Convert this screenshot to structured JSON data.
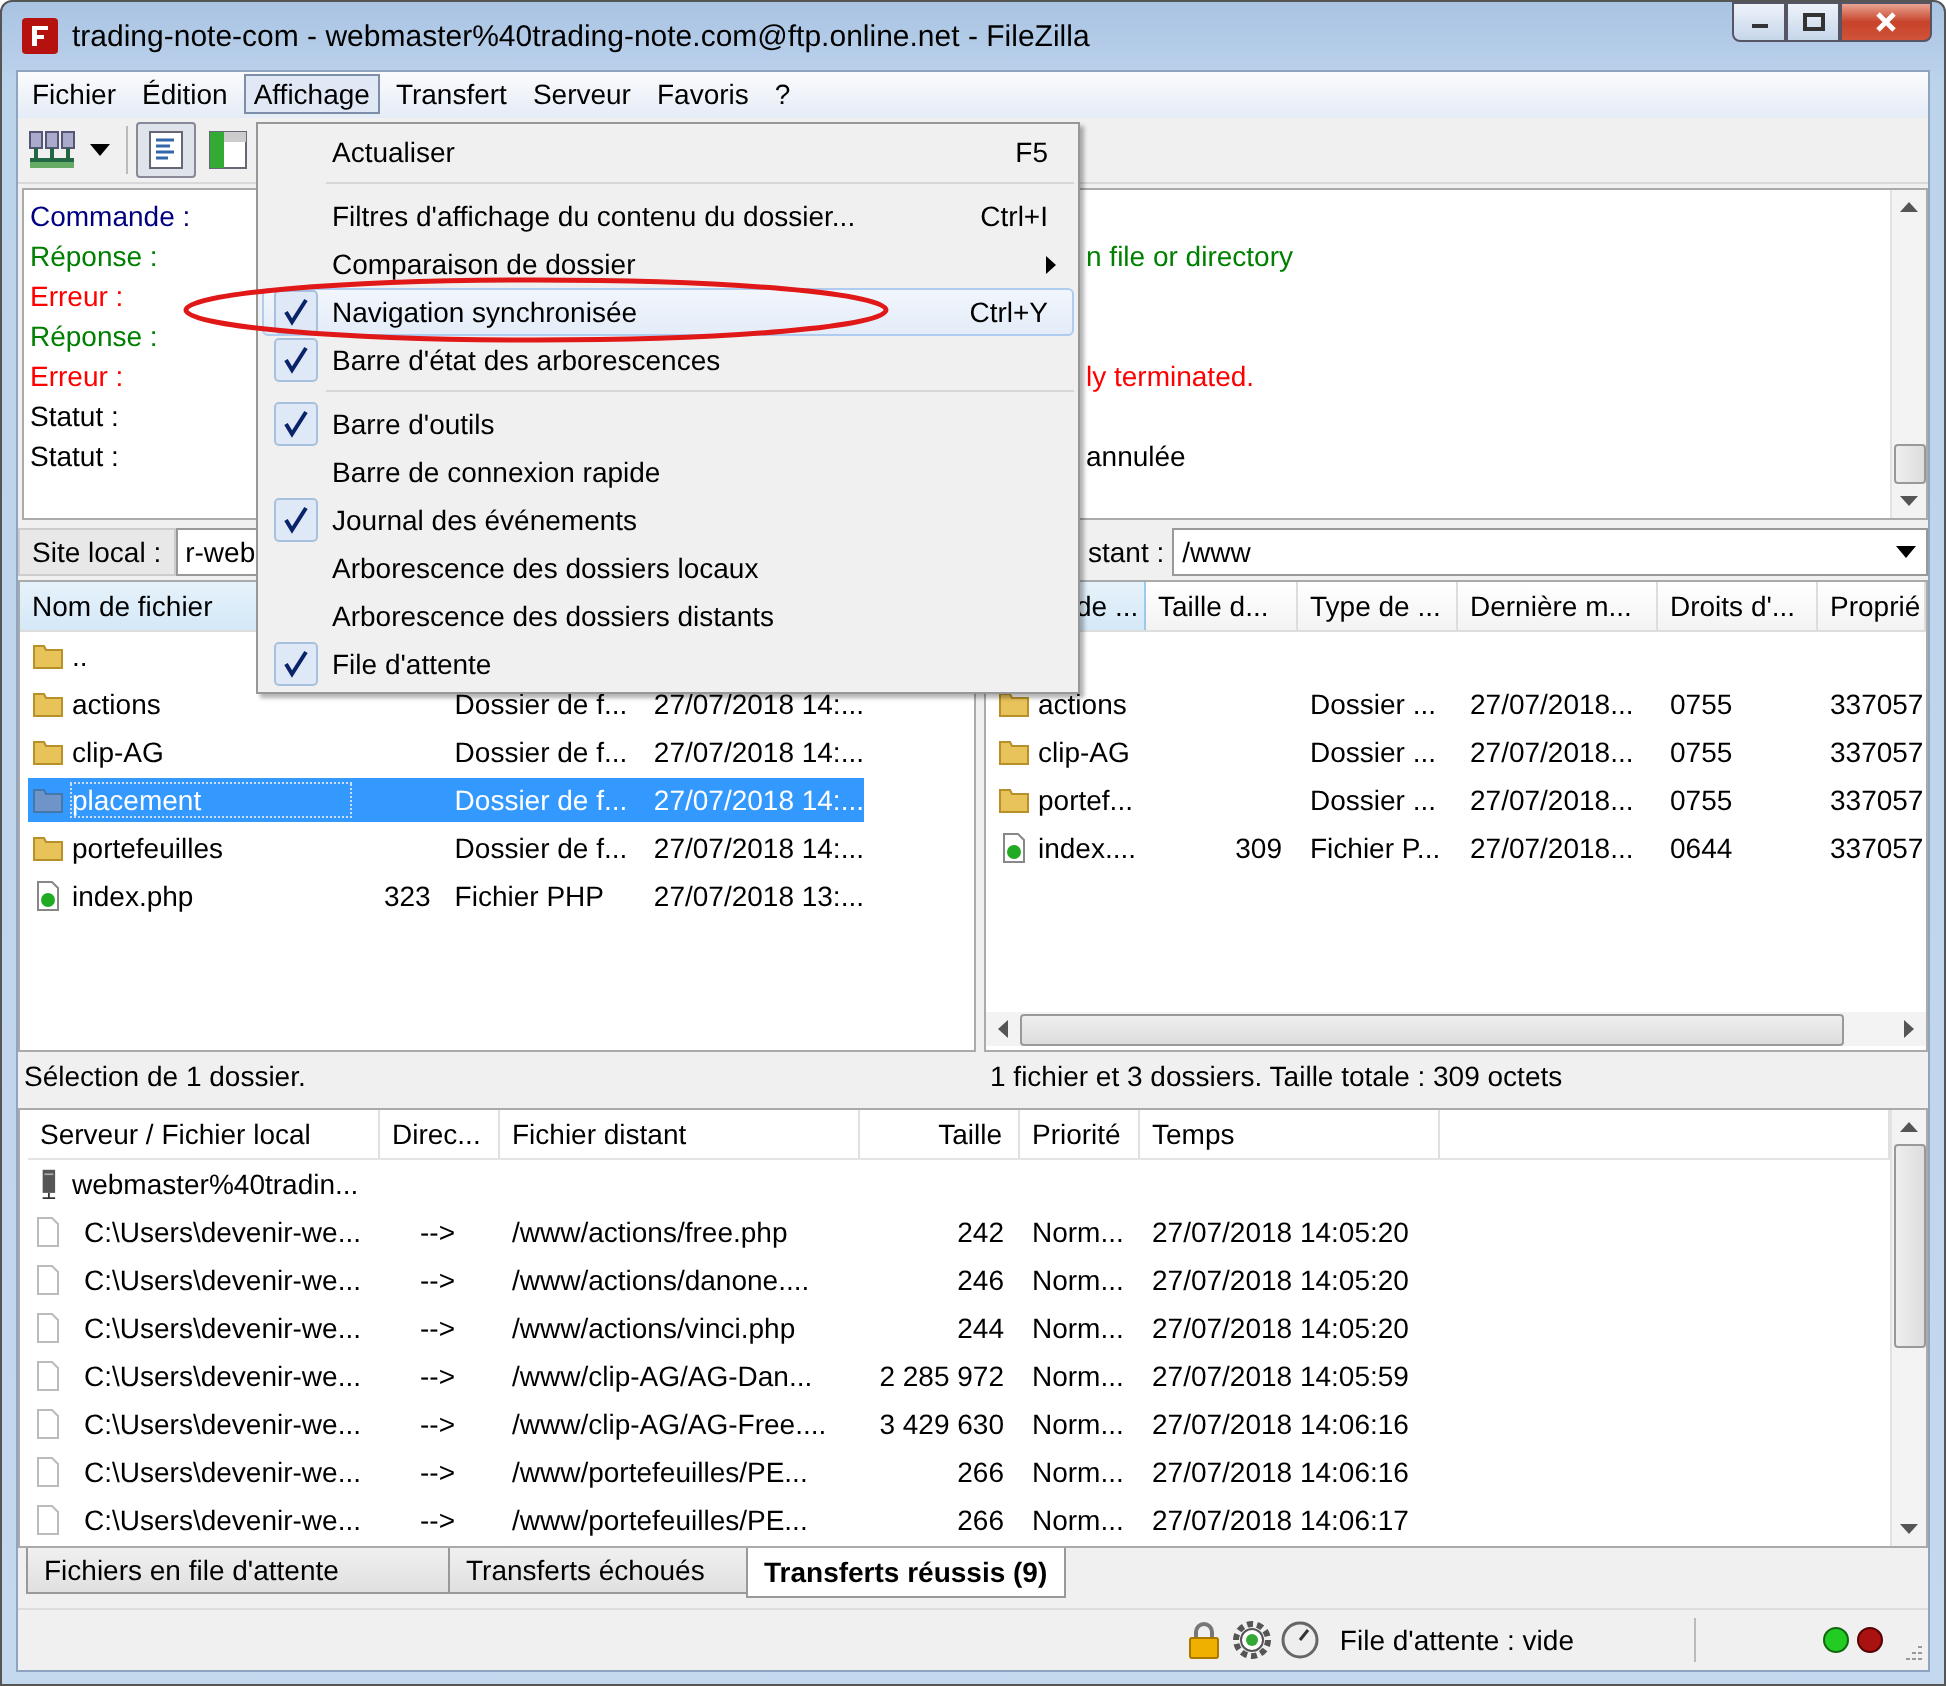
{
  "window": {
    "title": "trading-note-com - webmaster%40trading-note.com@ftp.online.net - FileZilla"
  },
  "menubar": [
    {
      "label": "Fichier",
      "selected": false
    },
    {
      "label": "Édition",
      "selected": false
    },
    {
      "label": "Affichage",
      "selected": true
    },
    {
      "label": "Transfert",
      "selected": false
    },
    {
      "label": "Serveur",
      "selected": false
    },
    {
      "label": "Favoris",
      "selected": false
    },
    {
      "label": "?",
      "selected": false
    }
  ],
  "open_menu": {
    "items": [
      {
        "kind": "item",
        "label": "Actualiser",
        "shortcut": "F5",
        "checked": false,
        "highlighted": false
      },
      {
        "kind": "separator"
      },
      {
        "kind": "item",
        "label": "Filtres d'affichage du contenu du dossier...",
        "shortcut": "Ctrl+I",
        "checked": false,
        "highlighted": false
      },
      {
        "kind": "submenu",
        "label": "Comparaison de dossier",
        "checked": false,
        "highlighted": false
      },
      {
        "kind": "item",
        "label": "Navigation synchronisée",
        "shortcut": "Ctrl+Y",
        "checked": true,
        "highlighted": true
      },
      {
        "kind": "item",
        "label": "Barre d'état des arborescences",
        "checked": true,
        "highlighted": false
      },
      {
        "kind": "separator"
      },
      {
        "kind": "item",
        "label": "Barre d'outils",
        "checked": true,
        "highlighted": false
      },
      {
        "kind": "item",
        "label": "Barre de connexion rapide",
        "checked": false,
        "highlighted": false
      },
      {
        "kind": "item",
        "label": "Journal des événements",
        "checked": true,
        "highlighted": false
      },
      {
        "kind": "item",
        "label": "Arborescence des dossiers locaux",
        "checked": false,
        "highlighted": false
      },
      {
        "kind": "item",
        "label": "Arborescence des dossiers distants",
        "checked": false,
        "highlighted": false
      },
      {
        "kind": "item",
        "label": "File d'attente",
        "checked": true,
        "highlighted": false
      }
    ]
  },
  "log": [
    {
      "kind": "command",
      "label": "Commande :"
    },
    {
      "kind": "response",
      "label": "Réponse :",
      "message": "n file or directory"
    },
    {
      "kind": "error",
      "label": "Erreur :"
    },
    {
      "kind": "response",
      "label": "Réponse :"
    },
    {
      "kind": "error",
      "label": "Erreur :",
      "message": "ly terminated."
    },
    {
      "kind": "status",
      "label": "Statut :"
    },
    {
      "kind": "status",
      "label": "Statut :",
      "message": "annulée"
    }
  ],
  "local": {
    "path_label": "Site local :",
    "path": "r-web",
    "columns": [
      {
        "label": "Nom de fichier",
        "sorted": true
      }
    ],
    "rows": [
      {
        "kind": "folder",
        "name": "..",
        "selected": false
      },
      {
        "kind": "folder",
        "name": "actions",
        "type": "Dossier de f...",
        "modified": "27/07/2018 14:...",
        "selected": false
      },
      {
        "kind": "folder",
        "name": "clip-AG",
        "type": "Dossier de f...",
        "modified": "27/07/2018 14:...",
        "selected": false
      },
      {
        "kind": "folder",
        "name": "placement",
        "type": "Dossier de f...",
        "modified": "27/07/2018 14:...",
        "selected": true
      },
      {
        "kind": "folder",
        "name": "portefeuilles",
        "type": "Dossier de f...",
        "modified": "27/07/2018 14:...",
        "selected": false
      },
      {
        "kind": "php",
        "name": "index.php",
        "size": "323",
        "type": "Fichier PHP",
        "modified": "27/07/2018 13:...",
        "selected": false
      }
    ],
    "status": "Sélection de 1 dossier."
  },
  "remote": {
    "path_label": "stant :",
    "path": "/www",
    "columns": [
      {
        "label": "de ...",
        "sorted": true
      },
      {
        "label": "Taille d...",
        "sorted": false
      },
      {
        "label": "Type de ...",
        "sorted": false
      },
      {
        "label": "Dernière m...",
        "sorted": false
      },
      {
        "label": "Droits d'...",
        "sorted": false
      },
      {
        "label": "Proprié",
        "sorted": false
      }
    ],
    "rows": [
      {
        "kind": "folder",
        "name": "actions",
        "type": "Dossier ...",
        "modified": "27/07/2018...",
        "permissions": "0755",
        "owner": "337057"
      },
      {
        "kind": "folder",
        "name": "clip-AG",
        "type": "Dossier ...",
        "modified": "27/07/2018...",
        "permissions": "0755",
        "owner": "337057"
      },
      {
        "kind": "folder",
        "name": "portef...",
        "type": "Dossier ...",
        "modified": "27/07/2018...",
        "permissions": "0755",
        "owner": "337057"
      },
      {
        "kind": "php",
        "name": "index....",
        "size": "309",
        "type": "Fichier P...",
        "modified": "27/07/2018...",
        "permissions": "0644",
        "owner": "337057"
      }
    ],
    "status": "1 fichier et 3 dossiers. Taille totale : 309 octets"
  },
  "queue": {
    "columns": [
      "Serveur / Fichier local",
      "Direc...",
      "Fichier distant",
      "Taille",
      "Priorité",
      "Temps"
    ],
    "rows": [
      {
        "kind": "server",
        "local": "webmaster%40tradin..."
      },
      {
        "kind": "file",
        "local": "C:\\Users\\devenir-we...",
        "direction": "-->",
        "remote": "/www/actions/free.php",
        "size": "242",
        "priority": "Norm...",
        "time": "27/07/2018 14:05:20"
      },
      {
        "kind": "file",
        "local": "C:\\Users\\devenir-we...",
        "direction": "-->",
        "remote": "/www/actions/danone....",
        "size": "246",
        "priority": "Norm...",
        "time": "27/07/2018 14:05:20"
      },
      {
        "kind": "file",
        "local": "C:\\Users\\devenir-we...",
        "direction": "-->",
        "remote": "/www/actions/vinci.php",
        "size": "244",
        "priority": "Norm...",
        "time": "27/07/2018 14:05:20"
      },
      {
        "kind": "file",
        "local": "C:\\Users\\devenir-we...",
        "direction": "-->",
        "remote": "/www/clip-AG/AG-Dan...",
        "size": "2 285 972",
        "priority": "Norm...",
        "time": "27/07/2018 14:05:59"
      },
      {
        "kind": "file",
        "local": "C:\\Users\\devenir-we...",
        "direction": "-->",
        "remote": "/www/clip-AG/AG-Free....",
        "size": "3 429 630",
        "priority": "Norm...",
        "time": "27/07/2018 14:06:16"
      },
      {
        "kind": "file",
        "local": "C:\\Users\\devenir-we...",
        "direction": "-->",
        "remote": "/www/portefeuilles/PE...",
        "size": "266",
        "priority": "Norm...",
        "time": "27/07/2018 14:06:16"
      },
      {
        "kind": "file",
        "local": "C:\\Users\\devenir-we...",
        "direction": "-->",
        "remote": "/www/portefeuilles/PE...",
        "size": "266",
        "priority": "Norm...",
        "time": "27/07/2018 14:06:17"
      }
    ]
  },
  "queue_tabs": [
    {
      "label": "Fichiers en file d'attente",
      "selected": false
    },
    {
      "label": "Transferts échoués",
      "selected": false
    },
    {
      "label": "Transferts réussis (9)",
      "selected": true
    }
  ],
  "status_bar": {
    "queue": "File d'attente : vide"
  }
}
